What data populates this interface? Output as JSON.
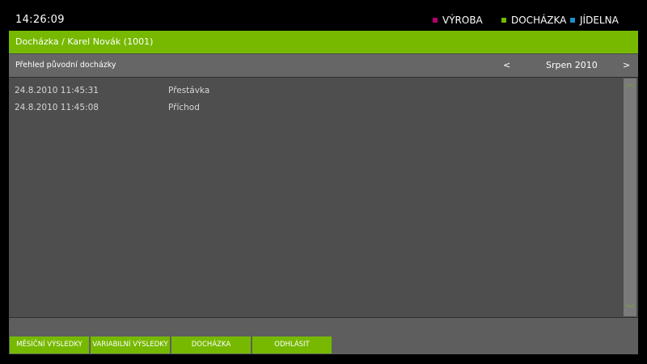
{
  "header": {
    "clock": "14:26:09",
    "modules": [
      {
        "label": "VÝROBA",
        "color": "#b3006e"
      },
      {
        "label": "DOCHÁZKA",
        "color": "#76b900"
      },
      {
        "label": "JÍDELNA",
        "color": "#1e90c8"
      }
    ]
  },
  "window": {
    "title": "Docházka / Karel Novák (1001)",
    "subtitle": "Přehled původní docházky",
    "prev": "<",
    "month": "Srpen 2010",
    "next": ">"
  },
  "records": [
    {
      "datetime": "24.8.2010 11:45:31",
      "event": "Přestávka"
    },
    {
      "datetime": "24.8.2010 11:45:08",
      "event": "Příchod"
    }
  ],
  "scroll": {
    "up": "︿",
    "down": "﹀"
  },
  "tabs": [
    {
      "label": "MĚSÍČNÍ VÝSLEDKY"
    },
    {
      "label": "VARIABILNÍ VÝSLEDKY"
    },
    {
      "label": "DOCHÁZKA"
    },
    {
      "label": "ODHLÁSIT"
    }
  ],
  "colors": {
    "accent": "#76b900",
    "background": "#000000",
    "panel": "#4a4a4a"
  }
}
